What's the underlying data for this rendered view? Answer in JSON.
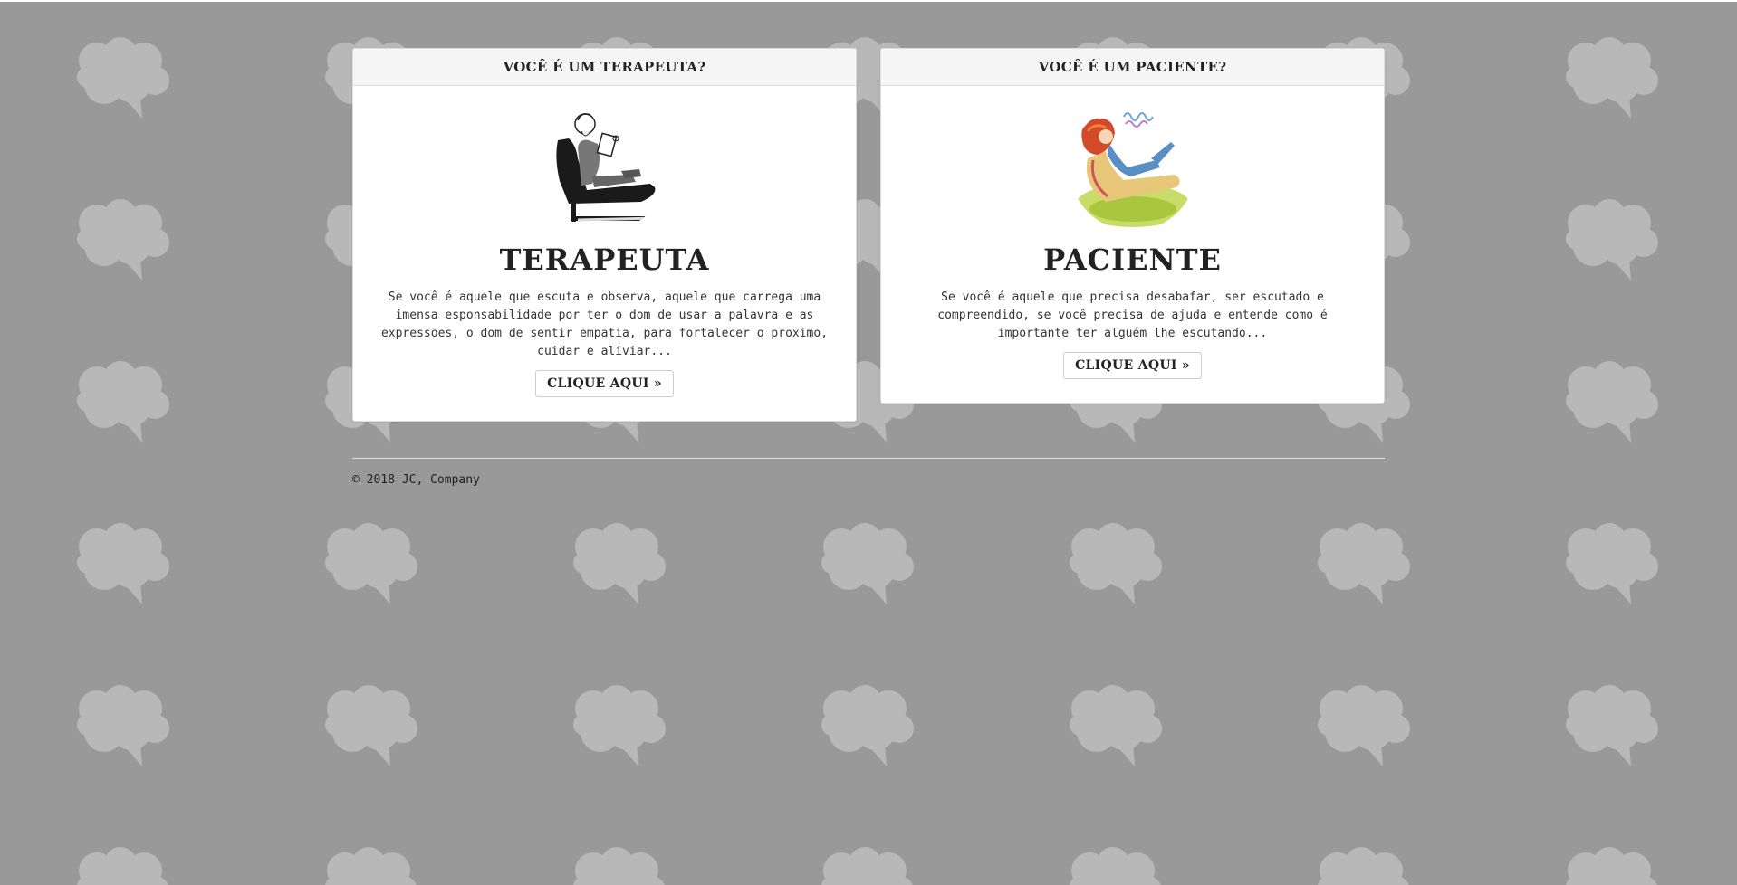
{
  "background": {
    "color": "#999999",
    "pattern_icon": "brain-icon",
    "pattern_color": "#b8b8b8"
  },
  "cards": [
    {
      "header": "VOCÊ É UM TERAPEUTA?",
      "illustration": "therapist-in-chair-illustration",
      "title": "TERAPEUTA",
      "text": "Se você é aquele que escuta e observa, aquele que carrega uma imensa esponsabilidade por ter o dom de usar a palavra e as expressões, o dom de sentir empatia, para fortalecer o proximo, cuidar e aliviar...",
      "button": "CLIQUE AQUI »"
    },
    {
      "header": "VOCÊ É UM PACIENTE?",
      "illustration": "patient-on-couch-illustration",
      "title": "PACIENTE",
      "text": "Se você é aquele que precisa desabafar, ser escutado e compreendido, se você precisa de ajuda e entende como é importante ter alguém lhe escutando...",
      "button": "CLIQUE AQUI »"
    }
  ],
  "footer": {
    "copyright": "© 2018 JC, Company"
  }
}
